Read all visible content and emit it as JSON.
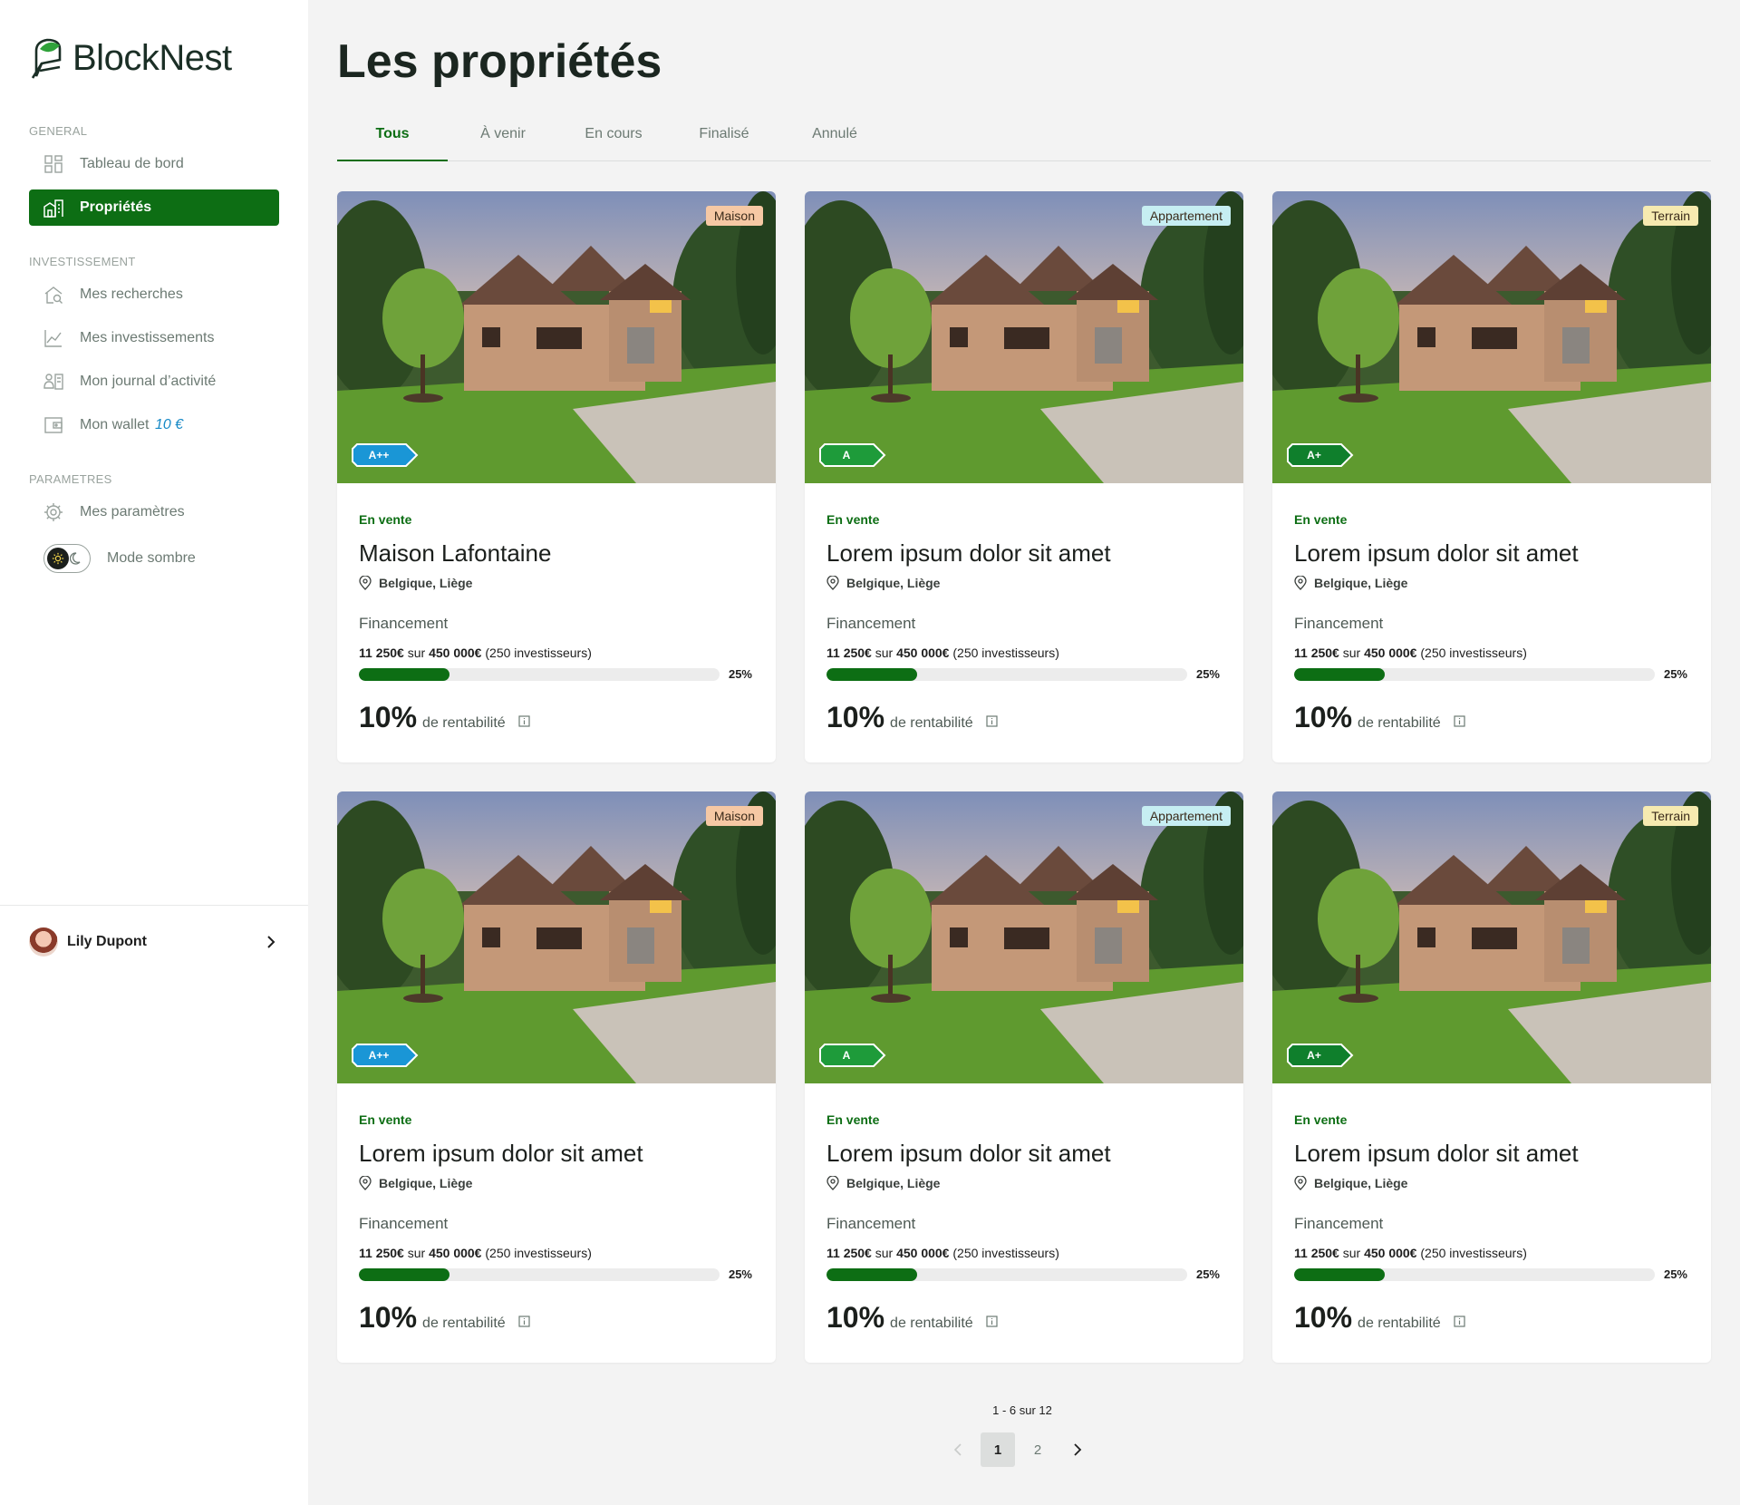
{
  "brand": {
    "name": "BlockNest",
    "color": "#0d6e14"
  },
  "sidebar": {
    "sections": [
      {
        "label": "GENERAL"
      },
      {
        "label": "INVESTISSEMENT"
      },
      {
        "label": "PARAMETRES"
      }
    ],
    "items": [
      {
        "label": "Tableau de bord",
        "icon": "dashboard-icon"
      },
      {
        "label": "Propriétés",
        "icon": "building-icon",
        "active": true
      },
      {
        "label": "Mes recherches",
        "icon": "home-search-icon"
      },
      {
        "label": "Mes investissements",
        "icon": "chart-line-icon"
      },
      {
        "label": "Mon journal d’activité",
        "icon": "activity-log-icon"
      },
      {
        "label": "Mon wallet",
        "amount": "10 €",
        "icon": "wallet-icon"
      },
      {
        "label": "Mes paramètres",
        "icon": "gear-icon"
      }
    ],
    "dark_mode": {
      "label": "Mode sombre",
      "enabled": false
    },
    "user": {
      "name": "Lily Dupont"
    }
  },
  "main": {
    "title": "Les propriétés",
    "tabs": [
      {
        "label": "Tous",
        "active": true
      },
      {
        "label": "À venir"
      },
      {
        "label": "En cours"
      },
      {
        "label": "Finalisé"
      },
      {
        "label": "Annulé"
      }
    ],
    "cards": [
      {
        "type": "Maison",
        "type_color": "#f6c8a4",
        "energy": "A++",
        "energy_color": "#1a96d6",
        "status": "En vente",
        "title": "Maison Lafontaine",
        "location": "Belgique, Liège",
        "fin_label": "Financement",
        "raised": "11 250€",
        "sur": "sur",
        "goal": "450 000€",
        "investors": "(250 investisseurs)",
        "progress": 25,
        "pct": "25%",
        "yield": "10%",
        "yield_label": "de rentabilité"
      },
      {
        "type": "Appartement",
        "type_color": "#c6eef2",
        "energy": "A",
        "energy_color": "#1e9b3a",
        "status": "En vente",
        "title": "Lorem ipsum dolor sit amet",
        "location": "Belgique, Liège",
        "fin_label": "Financement",
        "raised": "11 250€",
        "sur": "sur",
        "goal": "450 000€",
        "investors": "(250 investisseurs)",
        "progress": 25,
        "pct": "25%",
        "yield": "10%",
        "yield_label": "de rentabilité"
      },
      {
        "type": "Terrain",
        "type_color": "#f6eab0",
        "energy": "A+",
        "energy_color": "#0f7f2c",
        "status": "En vente",
        "title": "Lorem ipsum dolor sit amet",
        "location": "Belgique, Liège",
        "fin_label": "Financement",
        "raised": "11 250€",
        "sur": "sur",
        "goal": "450 000€",
        "investors": "(250 investisseurs)",
        "progress": 25,
        "pct": "25%",
        "yield": "10%",
        "yield_label": "de rentabilité"
      },
      {
        "type": "Maison",
        "type_color": "#f6c8a4",
        "energy": "A++",
        "energy_color": "#1a96d6",
        "status": "En vente",
        "title": "Lorem ipsum dolor sit amet",
        "location": "Belgique, Liège",
        "fin_label": "Financement",
        "raised": "11 250€",
        "sur": "sur",
        "goal": "450 000€",
        "investors": "(250 investisseurs)",
        "progress": 25,
        "pct": "25%",
        "yield": "10%",
        "yield_label": "de rentabilité"
      },
      {
        "type": "Appartement",
        "type_color": "#c6eef2",
        "energy": "A",
        "energy_color": "#1e9b3a",
        "status": "En vente",
        "title": "Lorem ipsum dolor sit amet",
        "location": "Belgique, Liège",
        "fin_label": "Financement",
        "raised": "11 250€",
        "sur": "sur",
        "goal": "450 000€",
        "investors": "(250 investisseurs)",
        "progress": 25,
        "pct": "25%",
        "yield": "10%",
        "yield_label": "de rentabilité"
      },
      {
        "type": "Terrain",
        "type_color": "#f6eab0",
        "energy": "A+",
        "energy_color": "#0f7f2c",
        "status": "En vente",
        "title": "Lorem ipsum dolor sit amet",
        "location": "Belgique, Liège",
        "fin_label": "Financement",
        "raised": "11 250€",
        "sur": "sur",
        "goal": "450 000€",
        "investors": "(250 investisseurs)",
        "progress": 25,
        "pct": "25%",
        "yield": "10%",
        "yield_label": "de rentabilité"
      }
    ]
  },
  "pagination": {
    "count": "1 - 6 sur 12",
    "pages": [
      "1",
      "2"
    ],
    "current": "1"
  }
}
